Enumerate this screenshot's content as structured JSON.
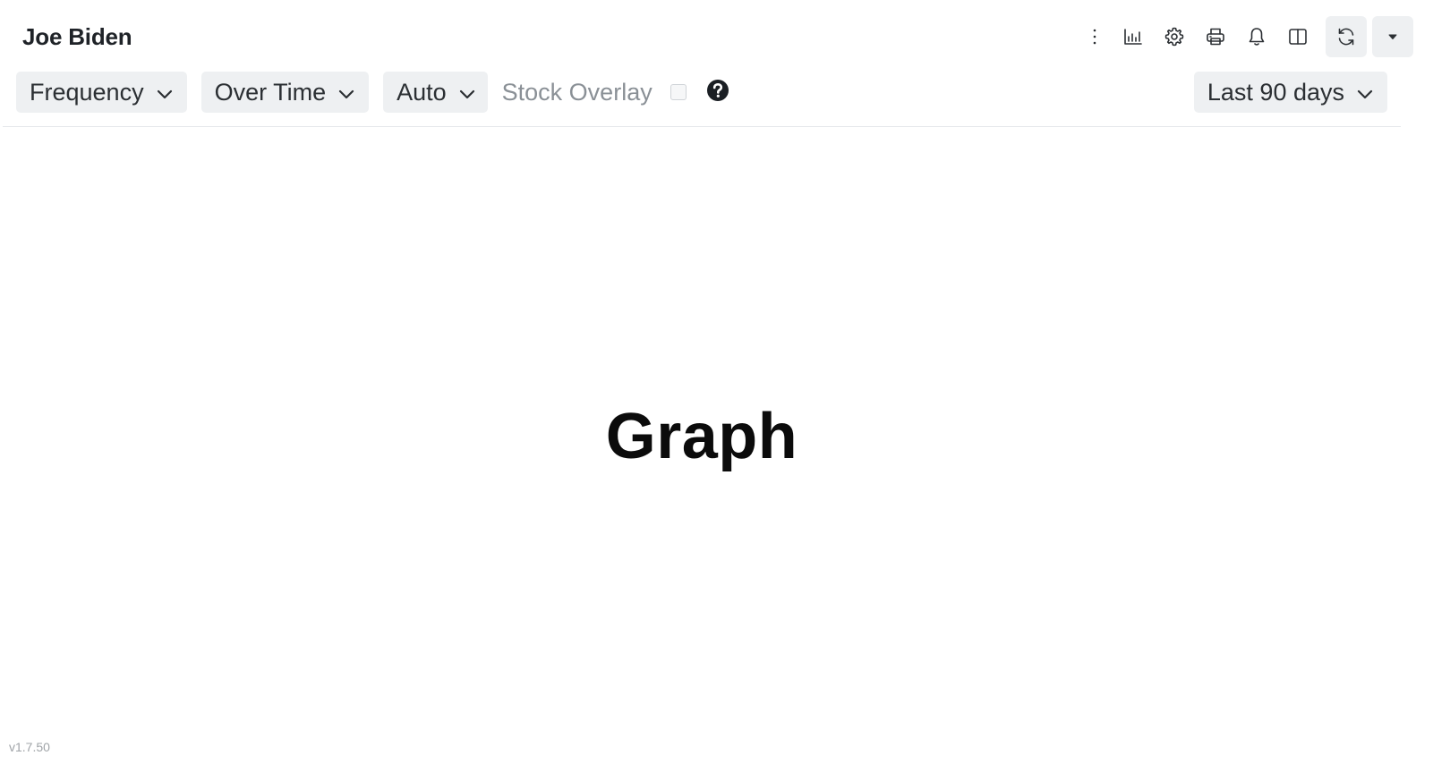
{
  "header": {
    "title": "Joe Biden",
    "icons": [
      {
        "name": "more-vertical-icon"
      },
      {
        "name": "bar-chart-icon"
      },
      {
        "name": "gear-icon"
      },
      {
        "name": "printer-icon"
      },
      {
        "name": "bell-icon"
      },
      {
        "name": "split-view-icon"
      },
      {
        "name": "refresh-icon"
      },
      {
        "name": "caret-down-icon"
      }
    ]
  },
  "controls": {
    "frequency_label": "Frequency",
    "over_time_label": "Over Time",
    "auto_label": "Auto",
    "stock_overlay_label": "Stock Overlay",
    "stock_overlay_checked": false,
    "help_icon": "question-circle-icon",
    "date_range_label": "Last 90 days"
  },
  "main": {
    "placeholder": "Graph"
  },
  "footer": {
    "version": "v1.7.50"
  },
  "colors": {
    "control_bg": "#eef0f2",
    "muted_text": "#8a9096",
    "text": "#212529"
  }
}
